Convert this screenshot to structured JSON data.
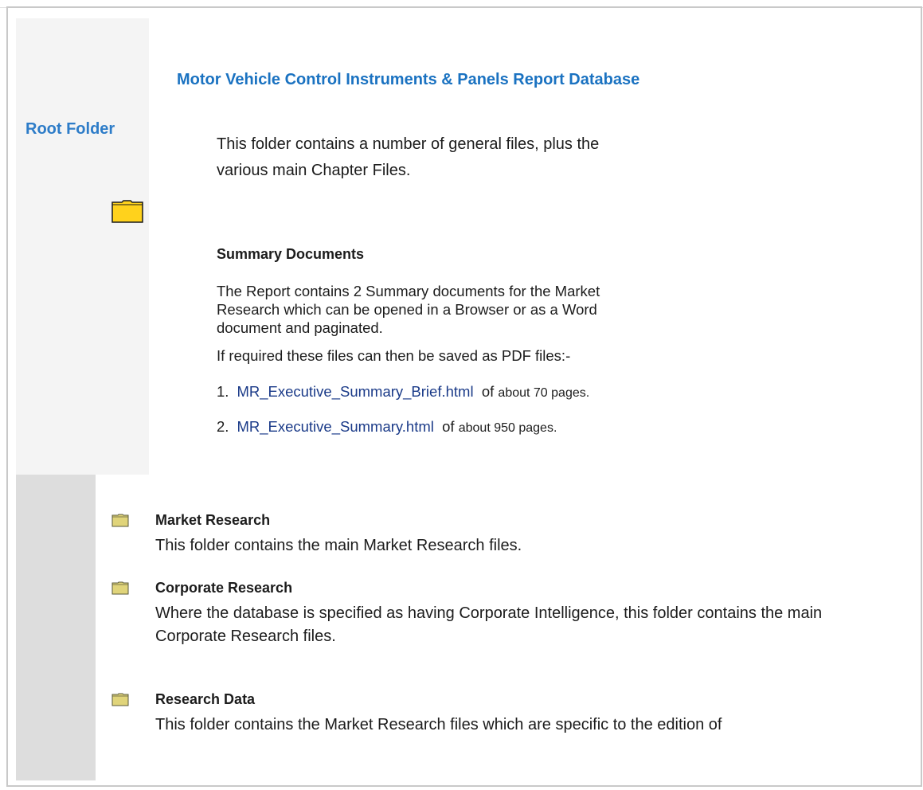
{
  "sidebar": {
    "root_label": "Root Folder",
    "folder_icon": "folder-icon"
  },
  "header": {
    "title": "Motor Vehicle Control Instruments & Panels Report Database"
  },
  "intro": {
    "text": "This folder contains a number of general files, plus the various main Chapter Files."
  },
  "summary": {
    "heading": "Summary Documents",
    "body": "The Report contains 2 Summary documents for the Market Research which can be opened in a Browser or as a Word document and paginated.",
    "pdf_note": "If required these files can then be saved as PDF files:-",
    "items": [
      {
        "num": "1.",
        "link": "MR_Executive_Summary_Brief.html",
        "of": "of",
        "pages": "about 70 pages."
      },
      {
        "num": "2.",
        "link": "MR_Executive_Summary.html",
        "of": "of",
        "pages": "about 950 pages."
      }
    ]
  },
  "folders": [
    {
      "name": "Market Research",
      "desc": "This folder contains the main Market Research files."
    },
    {
      "name": "Corporate Research",
      "desc": "Where the database is specified as having Corporate Intelligence, this folder contains the main Corporate Research files."
    },
    {
      "name": "Research Data",
      "desc": "This folder contains the Market Research files which are specific to the edition of"
    }
  ],
  "colors": {
    "title_blue": "#1a72c1",
    "link_blue": "#1a3a88",
    "folder_yellow": "#ffd21c"
  }
}
